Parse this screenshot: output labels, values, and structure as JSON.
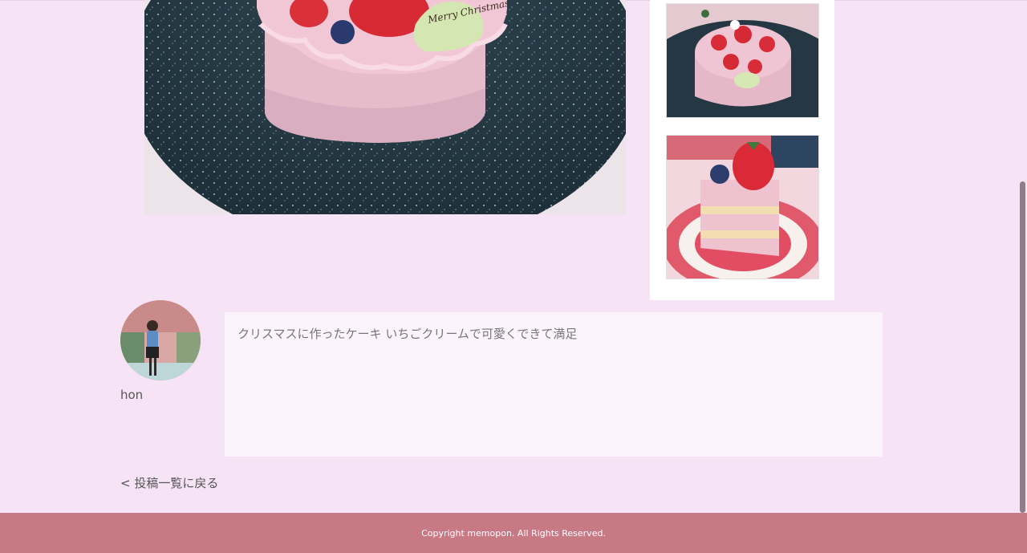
{
  "post": {
    "comment": "クリスマスに作ったケーキ いちごクリームで可愛くできて満足",
    "main_photo_icon": "cake-photo",
    "main_photo_text": "Merry Christmas"
  },
  "thumbnails": [
    {
      "icon": "cake-whole-photo"
    },
    {
      "icon": "cake-slice-photo"
    }
  ],
  "user": {
    "name": "hon",
    "avatar_icon": "user-avatar-photo"
  },
  "navigation": {
    "back_label": "< 投稿一覧に戻る"
  },
  "footer": {
    "copyright": "Copyright memopon. All Rights Reserved."
  },
  "colors": {
    "page_bg": "#f7e3f6",
    "footer_bg": "#c77a84",
    "comment_bg": "#fcf4fc"
  }
}
